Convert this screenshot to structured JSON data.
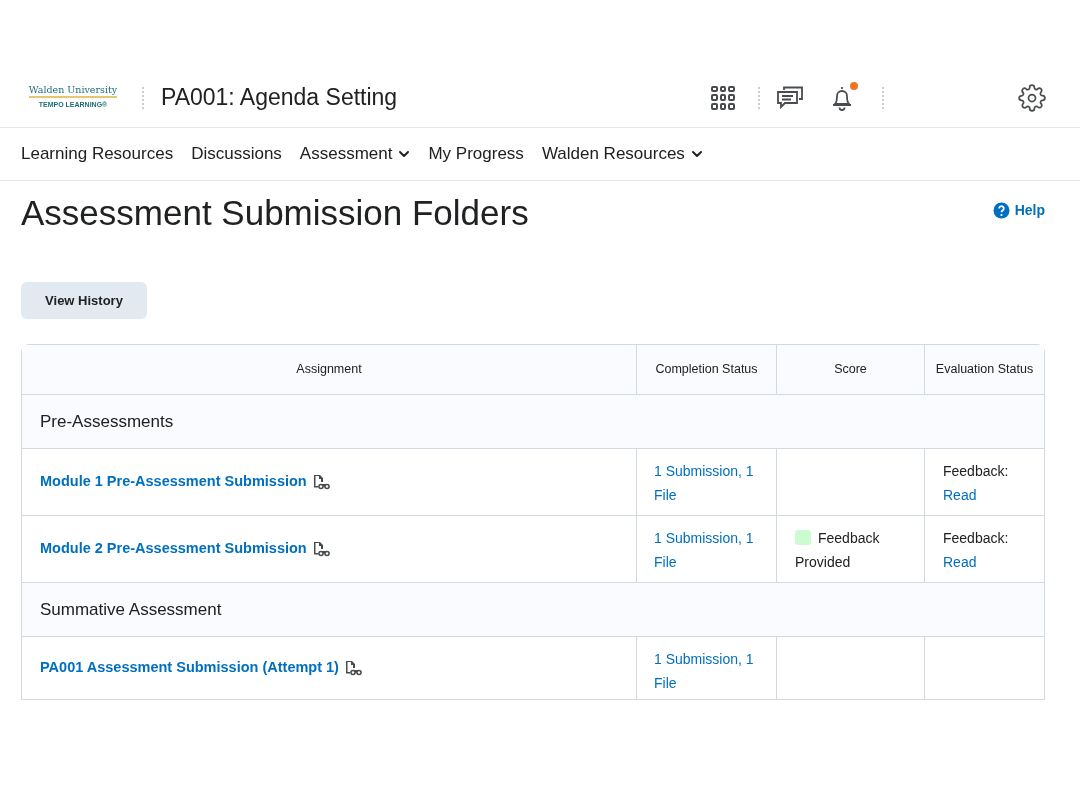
{
  "header": {
    "logo": {
      "name": "Walden University",
      "tagline": "TEMPO LEARNING®"
    },
    "course_title": "PA001: Agenda Setting",
    "notifications_unread": true
  },
  "nav": [
    {
      "label": "Learning Resources",
      "has_menu": false
    },
    {
      "label": "Discussions",
      "has_menu": false
    },
    {
      "label": "Assessment",
      "has_menu": true
    },
    {
      "label": "My Progress",
      "has_menu": false
    },
    {
      "label": "Walden Resources",
      "has_menu": true
    }
  ],
  "page_title": "Assessment Submission Folders",
  "help": "Help",
  "view_history_button": "View History",
  "table": {
    "columns": [
      "Assignment",
      "Completion Status",
      "Score",
      "Evaluation Status"
    ],
    "rows": [
      {
        "kind": "group",
        "title": "Pre-Assessments"
      },
      {
        "kind": "item",
        "assignment": "Module 1 Pre-Assessment Submission",
        "completion": "1 Submission, 1 File",
        "evaluation": {
          "label": "Feedback:",
          "link": "Read"
        }
      },
      {
        "kind": "item",
        "assignment": "Module 2 Pre-Assessment Submission",
        "completion": "1 Submission, 1 File",
        "score": {
          "text": "Feedback Provided",
          "color": "#ccfbd0"
        },
        "evaluation": {
          "label": "Feedback:",
          "link": "Read"
        }
      },
      {
        "kind": "group",
        "title": "Summative Assessment"
      },
      {
        "kind": "item",
        "assignment": "PA001 Assessment Submission (Attempt 1)",
        "completion": "1 Submission, 1 File"
      }
    ]
  }
}
